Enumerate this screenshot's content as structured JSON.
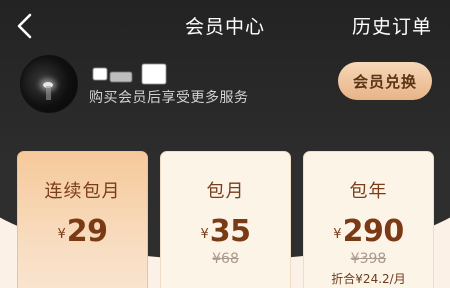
{
  "header": {
    "title": "会员中心",
    "history_label": "历史订单"
  },
  "user": {
    "subtitle": "购买会员后享受更多服务",
    "redeem_label": "会员兑换"
  },
  "plans": [
    {
      "name": "连续包月",
      "currency": "¥",
      "price": "29",
      "original": "",
      "note": "",
      "selected": true
    },
    {
      "name": "包月",
      "currency": "¥",
      "price": "35",
      "original": "¥68",
      "note": "",
      "selected": false
    },
    {
      "name": "包年",
      "currency": "¥",
      "price": "290",
      "original": "¥398",
      "note": "折合¥24.2/月",
      "selected": false
    }
  ],
  "colors": {
    "header_bg": "#232323",
    "accent_gold": "#e8b488",
    "price_brown": "#7a3a16"
  },
  "icons": {
    "back": "chevron-left-icon"
  }
}
